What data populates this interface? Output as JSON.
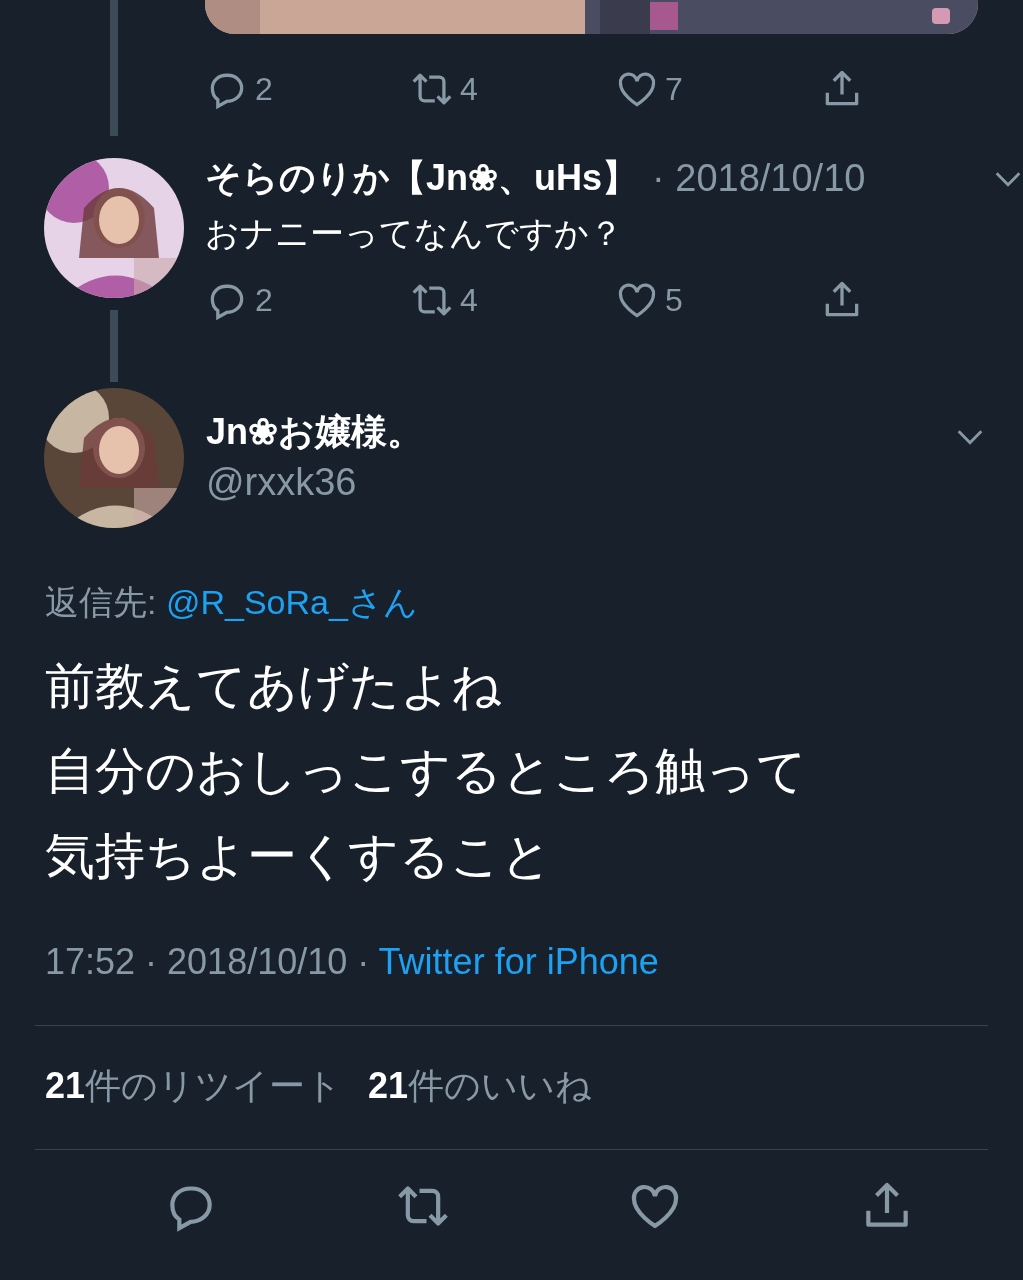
{
  "top_actions": {
    "replies": "2",
    "retweets": "4",
    "likes": "7"
  },
  "parent_tweet": {
    "name": "そらのりか【Jn❀、uHs】",
    "date": "· 2018/10/10",
    "text": "おナニーってなんですか？",
    "replies": "2",
    "retweets": "4",
    "likes": "5"
  },
  "main_tweet": {
    "name": "Jn❀お嬢様。",
    "handle": "@rxxk36",
    "reply_to_label": "返信先:",
    "reply_to": "@R_SoRa_さん",
    "text_lines": [
      "前教えてあげたよね",
      "自分のおしっこするところ触って",
      "気持ちよーくすること"
    ],
    "time": "17:52 · 2018/10/10 ·",
    "source": "Twitter for iPhone",
    "stats": [
      {
        "count": "21",
        "label": "件のリツイート"
      },
      {
        "count": "21",
        "label": "件のいいね"
      }
    ]
  },
  "action_bar": [
    {
      "kind": "reply"
    },
    {
      "kind": "retweet"
    },
    {
      "kind": "like"
    },
    {
      "kind": "share"
    }
  ]
}
